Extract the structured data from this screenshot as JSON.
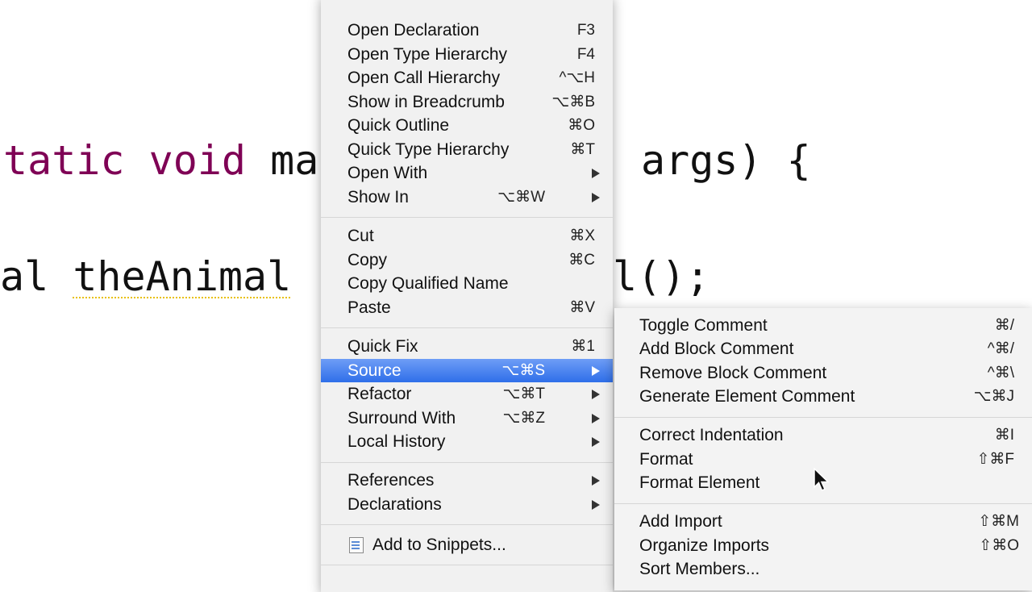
{
  "editor": {
    "line1": {
      "kw1": "tatic",
      "sp1": " ",
      "kw2": "void",
      "rest": " ma",
      "rest2": "args) {"
    },
    "line2": {
      "a": "al ",
      "b": "theAnimal",
      "c": "",
      "d": "l();"
    }
  },
  "main_menu": {
    "items": [
      {
        "label": "Open Declaration",
        "shortcut": "F3"
      },
      {
        "label": "Open Type Hierarchy",
        "shortcut": "F4"
      },
      {
        "label": "Open Call Hierarchy",
        "shortcut": "^⌥H"
      },
      {
        "label": "Show in Breadcrumb",
        "shortcut": "⌥⌘B"
      },
      {
        "label": "Quick Outline",
        "shortcut": "⌘O"
      },
      {
        "label": "Quick Type Hierarchy",
        "shortcut": "⌘T"
      },
      {
        "label": "Open With",
        "shortcut": ""
      },
      {
        "label": "Show In",
        "shortcut": "⌥⌘W"
      },
      {
        "label": "Cut",
        "shortcut": "⌘X"
      },
      {
        "label": "Copy",
        "shortcut": "⌘C"
      },
      {
        "label": "Copy Qualified Name",
        "shortcut": ""
      },
      {
        "label": "Paste",
        "shortcut": "⌘V"
      },
      {
        "label": "Quick Fix",
        "shortcut": "⌘1"
      },
      {
        "label": "Source",
        "shortcut": "⌥⌘S"
      },
      {
        "label": "Refactor",
        "shortcut": "⌥⌘T"
      },
      {
        "label": "Surround With",
        "shortcut": "⌥⌘Z"
      },
      {
        "label": "Local History",
        "shortcut": ""
      },
      {
        "label": "References",
        "shortcut": ""
      },
      {
        "label": "Declarations",
        "shortcut": ""
      },
      {
        "label": "Add to Snippets...",
        "shortcut": ""
      }
    ]
  },
  "source_submenu": {
    "items": [
      {
        "label": "Toggle Comment",
        "shortcut": "⌘/"
      },
      {
        "label": "Add Block Comment",
        "shortcut": "^⌘/"
      },
      {
        "label": "Remove Block Comment",
        "shortcut": "^⌘\\"
      },
      {
        "label": "Generate Element Comment",
        "shortcut": "⌥⌘J"
      },
      {
        "label": "Correct Indentation",
        "shortcut": "⌘I"
      },
      {
        "label": "Format",
        "shortcut": "⇧⌘F"
      },
      {
        "label": "Format Element",
        "shortcut": ""
      },
      {
        "label": "Add Import",
        "shortcut": "⇧⌘M"
      },
      {
        "label": "Organize Imports",
        "shortcut": "⇧⌘O"
      },
      {
        "label": "Sort Members...",
        "shortcut": ""
      }
    ]
  },
  "colors": {
    "selection": "#3e7ef0",
    "keyword": "#7f0055"
  },
  "icons": {
    "submenu_arrow": "triangle-right-icon",
    "snippet": "snippet-icon",
    "pointer": "mouse-pointer-icon"
  }
}
